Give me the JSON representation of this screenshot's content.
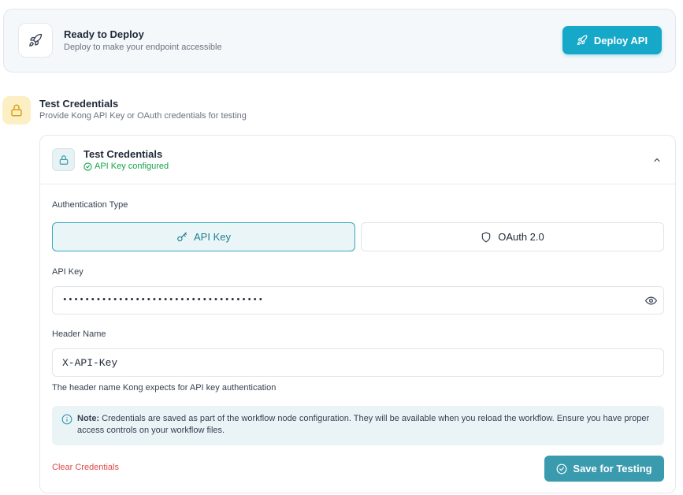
{
  "deploy": {
    "title": "Ready to Deploy",
    "subtitle": "Deploy to make your endpoint accessible",
    "button_label": "Deploy API"
  },
  "section": {
    "title": "Test Credentials",
    "subtitle": "Provide Kong API Key or OAuth credentials for testing"
  },
  "card": {
    "title": "Test Credentials",
    "status": "API Key configured"
  },
  "auth": {
    "label": "Authentication Type",
    "options": [
      {
        "label": "API Key",
        "selected": true
      },
      {
        "label": "OAuth 2.0",
        "selected": false
      }
    ]
  },
  "api_key": {
    "label": "API Key",
    "value": "••••••••••••••••••••••••••••••••••••"
  },
  "header_name": {
    "label": "Header Name",
    "value": "X-API-Key",
    "helper": "The header name Kong expects for API key authentication"
  },
  "note": {
    "prefix": "Note:",
    "text": " Credentials are saved as part of the workflow node configuration. They will be available when you reload the workflow. Ensure you have proper access controls on your workflow files."
  },
  "actions": {
    "clear_label": "Clear Credentials",
    "save_label": "Save for Testing"
  },
  "colors": {
    "accent": "#16a8c9",
    "save": "#3a9aae",
    "success": "#16a34a",
    "danger": "#e04848",
    "lock_bg": "#fdefc4"
  }
}
